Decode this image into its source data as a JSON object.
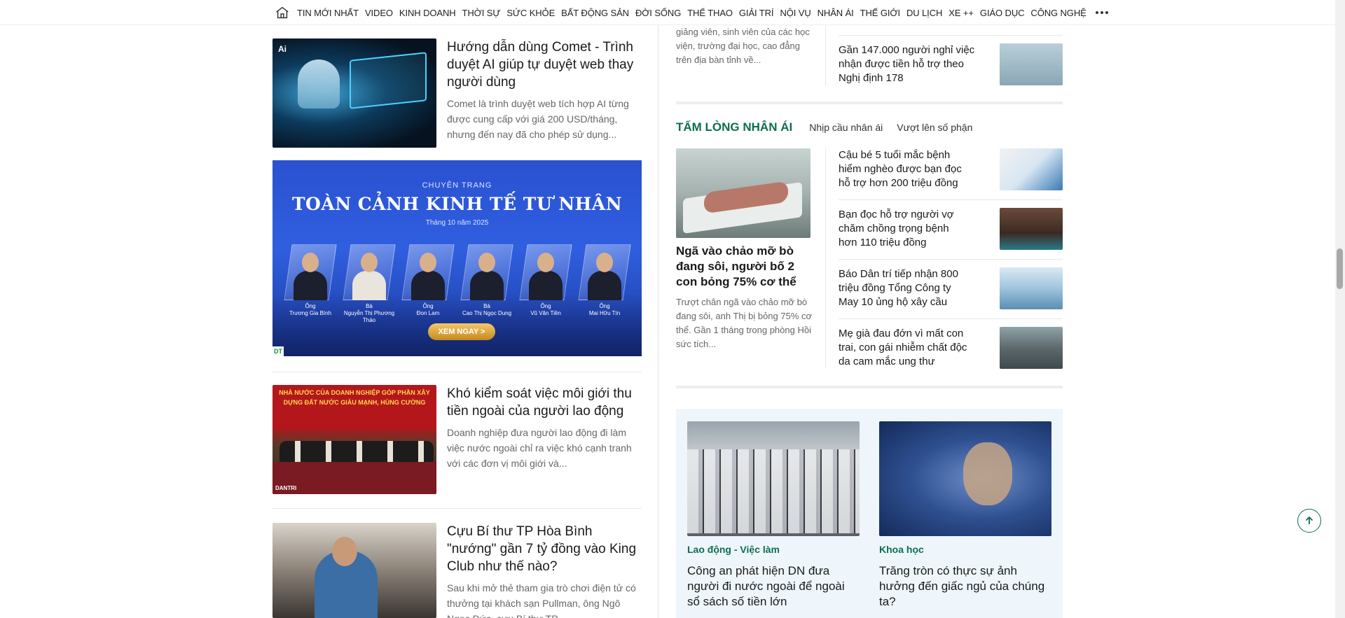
{
  "nav": {
    "items": [
      "TIN MỚI NHẤT",
      "VIDEO",
      "KINH DOANH",
      "THỜI SỰ",
      "SỨC KHỎE",
      "BẤT ĐỘNG SẢN",
      "ĐỜI SỐNG",
      "THỂ THAO",
      "GIẢI TRÍ",
      "NỘI VỤ",
      "NHÂN ÁI",
      "THẾ GIỚI",
      "DU LỊCH",
      "XE ++",
      "GIÁO DỤC",
      "CÔNG NGHỆ"
    ],
    "home_icon": "home-icon",
    "more_icon": "more-dots-icon"
  },
  "left": {
    "story1": {
      "title": "Hướng dẫn dùng Comet - Trình duyệt AI giúp tự duyệt web thay người dùng",
      "sapo": "Comet là trình duyệt web tích hợp AI từng được cung cấp với giá 200 USD/tháng, nhưng đến nay đã cho phép sử dụng...",
      "thumb_label": "Ai"
    },
    "banner": {
      "kicker": "CHUYÊN TRANG",
      "title": "TOÀN CẢNH KINH TẾ TƯ NHÂN",
      "date": "Tháng 10 năm 2025",
      "cta": "XEM NGAY >",
      "mark": "DT",
      "people": [
        {
          "honorific": "Ông",
          "name": "Trương Gia Bình"
        },
        {
          "honorific": "Bà",
          "name": "Nguyễn Thị Phương Thảo"
        },
        {
          "honorific": "Ông",
          "name": "Đon Lam"
        },
        {
          "honorific": "Bà",
          "name": "Cao Thị Ngọc Dung"
        },
        {
          "honorific": "Ông",
          "name": "Vũ Văn Tiền"
        },
        {
          "honorific": "Ông",
          "name": "Mai Hữu Tín"
        }
      ]
    },
    "story2": {
      "title": "Khó kiểm soát việc môi giới thu tiền ngoài của người lao động",
      "sapo": "Doanh nghiệp đưa người lao động đi làm việc nước ngoài chỉ ra việc khó cạnh tranh với các đơn vị môi giới và...",
      "thumb_banner": "NHÀ NƯỚC CỦA DOANH NGHIỆP GÓP PHẦN XÂY DỰNG ĐẤT NƯỚC GIÀU MẠNH, HÙNG CƯỜNG",
      "thumb_mark": "DANTRI"
    },
    "story3": {
      "title": "Cựu Bí thư TP Hòa Bình \"nướng\" gần 7 tỷ đồng vào King Club như thế nào?",
      "sapo": "Sau khi mở thẻ tham gia trò chơi điện tử có thưởng tại khách sạn Pullman, ông Ngô Ngọc Đức, cựu Bí thư TP..."
    }
  },
  "right": {
    "top": {
      "sapo": "giảng viên, sinh viên của các học viện, trường đại học, cao đẳng trên địa bàn tỉnh về...",
      "side_title": "Gần 147.000 người nghỉ việc nhận được tiền hỗ trợ theo Nghị định 178"
    },
    "section": {
      "title": "TẤM LÒNG NHÂN ÁI",
      "subs": [
        "Nhịp cầu nhân ái",
        "Vượt lên số phận"
      ]
    },
    "featured": {
      "title": "Ngã vào chảo mỡ bò đang sôi, người bố 2 con bỏng 75% cơ thể",
      "sapo": "Trượt chân ngã vào chảo mỡ bò đang sôi, anh Thị bị bỏng 75% cơ thể. Gần 1 tháng trong phòng Hồi sức tích..."
    },
    "list": [
      "Cậu bé 5 tuổi mắc bệnh hiểm nghèo được bạn đọc hỗ trợ hơn 200 triệu đồng",
      "Bạn đọc hỗ trợ người vợ chăm chồng trọng bệnh hơn 110 triệu đồng",
      "Báo Dân trí tiếp nhận 800 triệu đồng Tổng Công ty May 10 ủng hộ xây cầu",
      "Mẹ già đau đớn vì mất con trai, con gái nhiễm chất độc da cam mắc ung thư"
    ],
    "box": [
      {
        "category": "Lao động - Việc làm",
        "title": "Công an phát hiện DN đưa người đi nước ngoài để ngoài sổ sách số tiền lớn"
      },
      {
        "category": "Khoa học",
        "title": "Trăng tròn có thực sự ảnh hưởng đến giấc ngủ của chúng ta?"
      }
    ]
  },
  "colors": {
    "accent": "#0c6e4d",
    "banner_blue": "#2f5fe0",
    "box_bg": "#eef6fc"
  },
  "icons": {
    "back_to_top": "arrow-up-icon"
  }
}
